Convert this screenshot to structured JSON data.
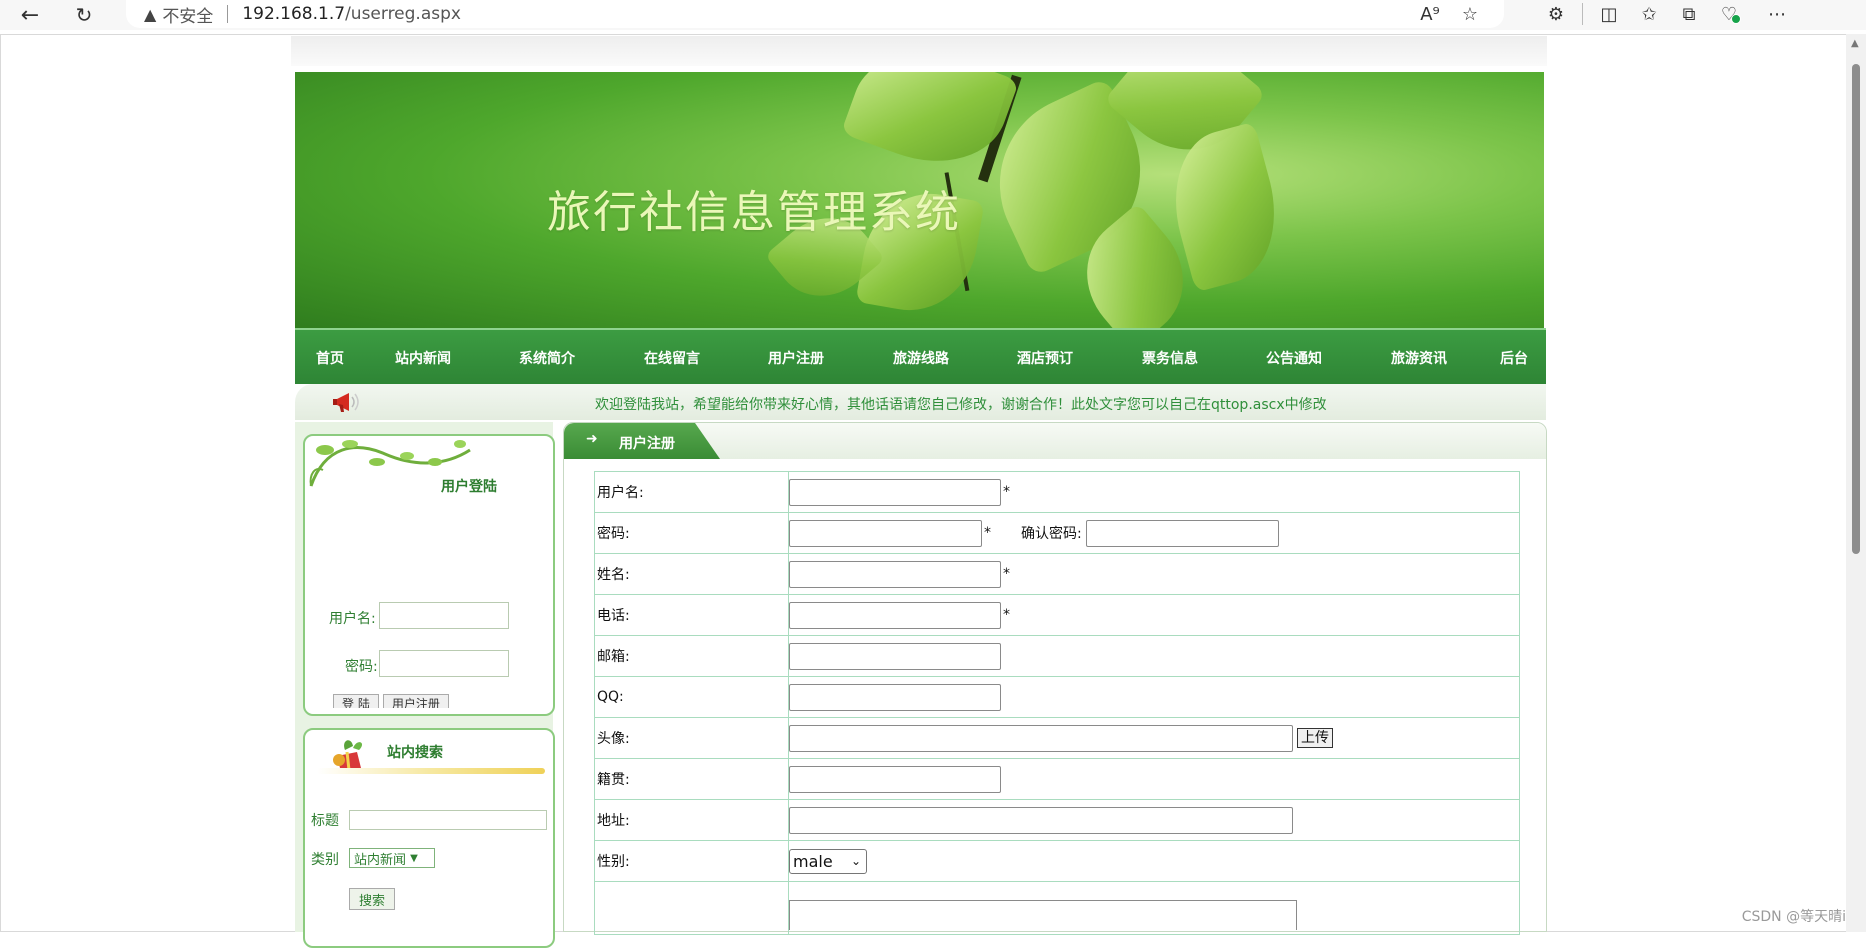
{
  "browser": {
    "security_label": "不安全",
    "url_host": "192.168.1.7",
    "url_path": "/userreg.aspx"
  },
  "site": {
    "title": "旅行社信息管理系统",
    "nav": [
      "首页",
      "站内新闻",
      "系统简介",
      "在线留言",
      "用户注册",
      "旅游线路",
      "酒店预订",
      "票务信息",
      "公告通知",
      "旅游资讯",
      "后台"
    ],
    "marquee": "欢迎登陆我站，希望能给你带来好心情，其他话语请您自己修改，谢谢合作！此处文字您可以自己在qttop.ascx中修改"
  },
  "login": {
    "title": "用户登陆",
    "username_label": "用户名:",
    "password_label": "密码:",
    "login_button": "登 陆",
    "register_button": "用户注册"
  },
  "search": {
    "title": "站内搜索",
    "title_label": "标题",
    "category_label": "类别",
    "category_value": "站内新闻",
    "search_button": "搜索"
  },
  "form": {
    "tab_label": "用户注册",
    "username_label": "用户名:",
    "password_label": "密码:",
    "confirm_password_label": "确认密码:",
    "name_label": "姓名:",
    "phone_label": "电话:",
    "email_label": "邮箱:",
    "qq_label": "QQ:",
    "avatar_label": "头像:",
    "upload_button": "上传",
    "hometown_label": "籍贯:",
    "address_label": "地址:",
    "gender_label": "性别:",
    "gender_value": "male",
    "required_mark": "*"
  },
  "watermark": "CSDN @等天晴i"
}
